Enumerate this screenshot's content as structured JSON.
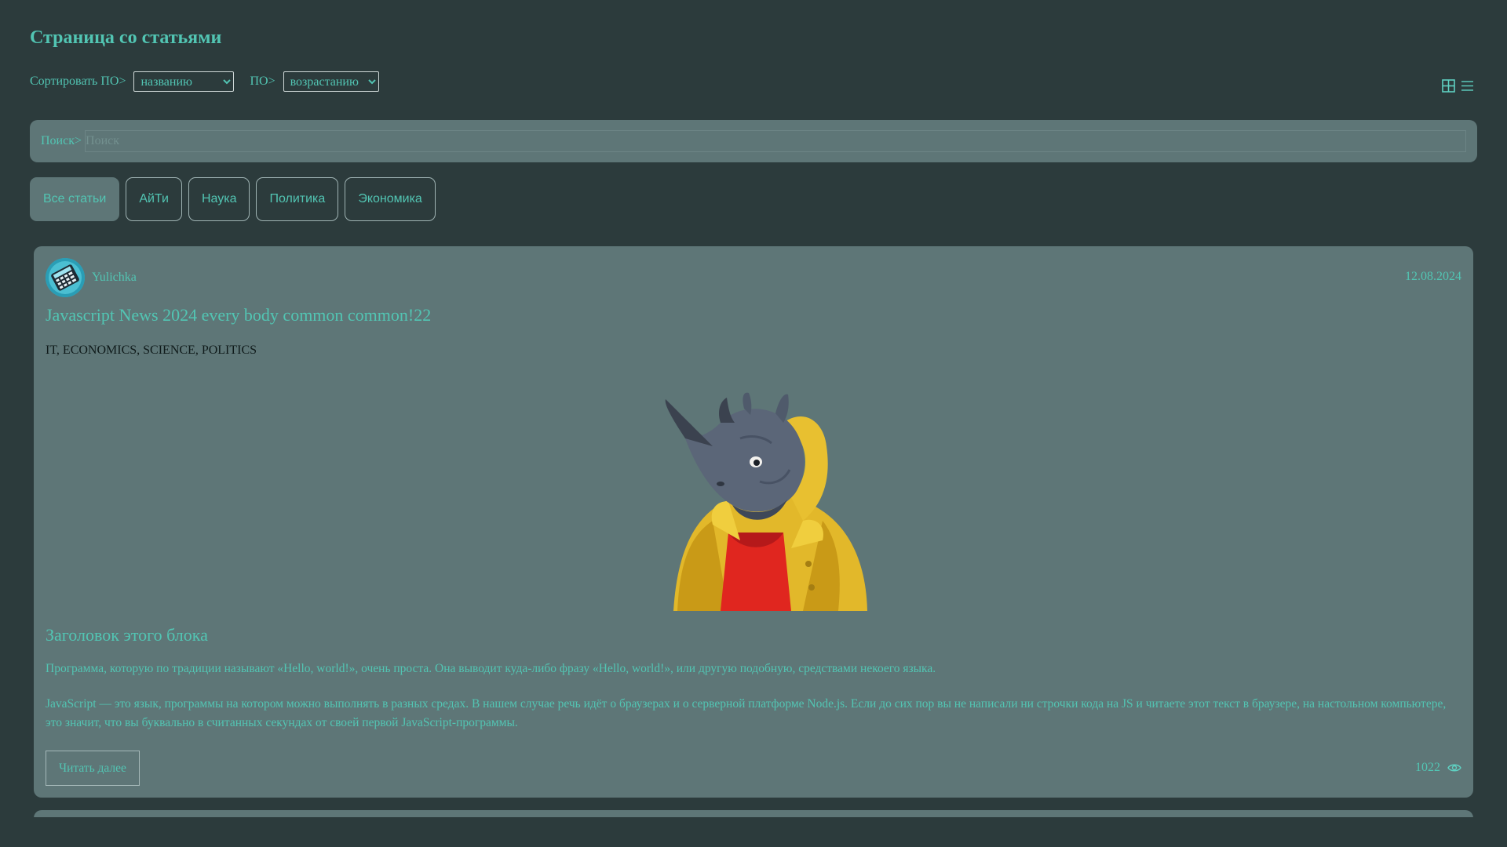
{
  "page": {
    "title": "Страница со статьями"
  },
  "sort": {
    "by_label": "Сортировать ПО>",
    "by_value": "названию",
    "order_label": "ПО>",
    "order_value": "возрастанию"
  },
  "view_toggle": {
    "grid_icon": "grid-view-icon",
    "list_icon": "list-view-icon"
  },
  "search": {
    "label": "Поиск>",
    "placeholder": "Поиск",
    "value": ""
  },
  "tabs": [
    {
      "label": "Все статьи",
      "active": true
    },
    {
      "label": "АйТи"
    },
    {
      "label": "Наука"
    },
    {
      "label": "Политика"
    },
    {
      "label": "Экономика"
    }
  ],
  "article": {
    "author": "Yulichka",
    "avatar_icon": "calculator-avatar-icon",
    "date": "12.08.2024",
    "title": "Javascript News 2024 every body common common!22",
    "tags": "IT, ECONOMICS, SCIENCE, POLITICS",
    "image": "rhino-in-yellow-jacket-illustration",
    "block_title": "Заголовок этого блока",
    "paragraph1": "Программа, которую по традиции называют «Hello, world!», очень проста. Она выводит куда-либо фразу «Hello, world!», или другую подобную, средствами некоего языка.",
    "paragraph2": "JavaScript — это язык, программы на котором можно выполнять в разных средах. В нашем случае речь идёт о браузерах и о серверной платформе Node.js. Если до сих пор вы не написали ни строчки кода на JS и читаете этот текст в браузере, на настольном компьютере, это значит, что вы буквально в считанных секундах от своей первой JavaScript-программы.",
    "read_more": "Читать далее",
    "views": "1022",
    "views_icon": "eye-icon"
  },
  "colors": {
    "background": "#2c3b3c",
    "card": "#5e7677",
    "accent": "#52c5b3",
    "tags_text": "#0f1a1a"
  }
}
